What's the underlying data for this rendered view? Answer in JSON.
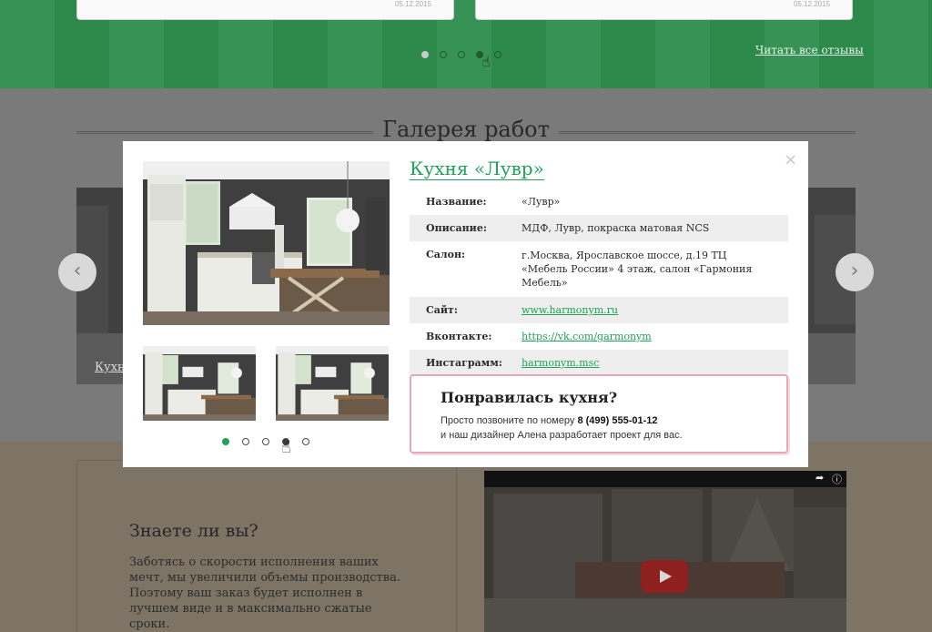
{
  "reviews": {
    "left_date": "05.12.2015",
    "right_date": "05.12.2015",
    "dots": [
      false,
      false,
      false,
      true,
      false
    ],
    "all_reviews_link": "Читать все отзывы"
  },
  "gallery": {
    "title": "Галерея работ",
    "left_caption": "Кухн"
  },
  "know": {
    "title": "Знаете ли вы?",
    "text": "Заботясь о скорости исполнения ваших мечт, мы увеличили объемы производства. Поэтому ваш заказ будет исполнен в лучшем виде и в максимально сжатые сроки."
  },
  "video": {
    "share_icon": "share-icon",
    "info_icon": "info-icon"
  },
  "modal": {
    "title": "Кухня «Лувр»",
    "close_label": "×",
    "rows": [
      {
        "label": "Название:",
        "value": "«Лувр»"
      },
      {
        "label": "Описание:",
        "value": "МДФ, Лувр, покраска матовая NCS"
      },
      {
        "label": "Салон:",
        "value_line1": "г.Москва, Ярославское шоссе, д.19 ТЦ",
        "value_line2": "«Мебель России» 4 этаж, салон «Гармония Мебель»"
      },
      {
        "label": "Сайт:",
        "value": "www.harmonym.ru"
      },
      {
        "label": "Вконтакте:",
        "value": "https://vk.com/garmonym"
      },
      {
        "label": "Инстаграмм:",
        "value": "harmonym.msc"
      }
    ],
    "dots": [
      true,
      false,
      false,
      false,
      false
    ],
    "cta": {
      "title": "Понравилась кухня?",
      "line1_prefix": "Просто позвоните по номеру",
      "phone": "8 (499) 555-01-12",
      "line2": "и наш дизайнер Алена разработает проект для вас."
    }
  },
  "colors": {
    "accent": "#23a05a",
    "green_band": "#2f8f4e",
    "cta_border": "#e5a8b4"
  }
}
